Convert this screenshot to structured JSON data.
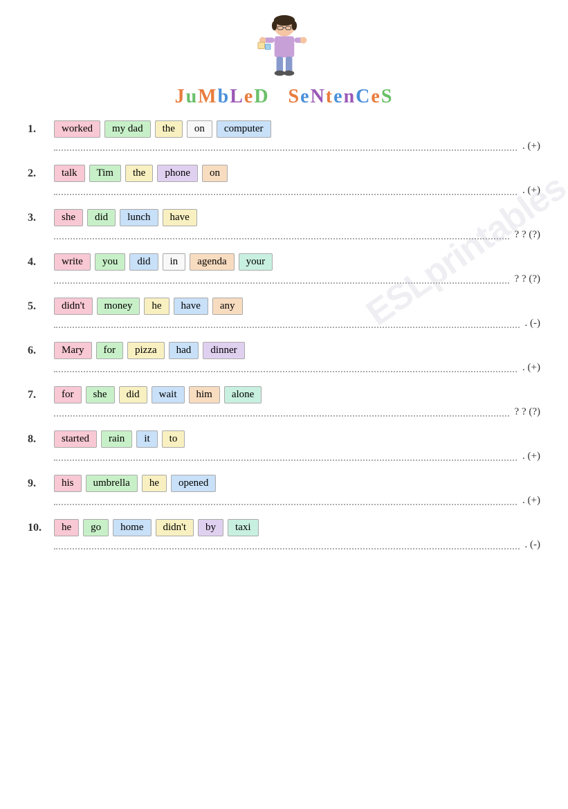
{
  "header": {
    "title": "JuMbLeD SeNtenCeS"
  },
  "exercises": [
    {
      "num": "1.",
      "words": [
        {
          "text": "worked",
          "color": "color-pink"
        },
        {
          "text": "my dad",
          "color": "color-green"
        },
        {
          "text": "the",
          "color": "color-yellow"
        },
        {
          "text": "on",
          "color": "color-white"
        },
        {
          "text": "computer",
          "color": "color-blue"
        }
      ],
      "type": "(+)"
    },
    {
      "num": "2.",
      "words": [
        {
          "text": "talk",
          "color": "color-pink"
        },
        {
          "text": "Tim",
          "color": "color-green"
        },
        {
          "text": "the",
          "color": "color-yellow"
        },
        {
          "text": "phone",
          "color": "color-lavender"
        },
        {
          "text": "on",
          "color": "color-peach"
        }
      ],
      "type": "(+)"
    },
    {
      "num": "3.",
      "words": [
        {
          "text": "she",
          "color": "color-pink"
        },
        {
          "text": "did",
          "color": "color-green"
        },
        {
          "text": "lunch",
          "color": "color-blue"
        },
        {
          "text": "have",
          "color": "color-yellow"
        }
      ],
      "type": "? (?)"
    },
    {
      "num": "4.",
      "words": [
        {
          "text": "write",
          "color": "color-pink"
        },
        {
          "text": "you",
          "color": "color-green"
        },
        {
          "text": "did",
          "color": "color-blue"
        },
        {
          "text": "in",
          "color": "color-white"
        },
        {
          "text": "agenda",
          "color": "color-peach"
        },
        {
          "text": "your",
          "color": "color-mint"
        }
      ],
      "type": "? (?)"
    },
    {
      "num": "5.",
      "words": [
        {
          "text": "didn't",
          "color": "color-pink"
        },
        {
          "text": "money",
          "color": "color-green"
        },
        {
          "text": "he",
          "color": "color-yellow"
        },
        {
          "text": "have",
          "color": "color-blue"
        },
        {
          "text": "any",
          "color": "color-peach"
        }
      ],
      "type": "(-)"
    },
    {
      "num": "6.",
      "words": [
        {
          "text": "Mary",
          "color": "color-pink"
        },
        {
          "text": "for",
          "color": "color-green"
        },
        {
          "text": "pizza",
          "color": "color-yellow"
        },
        {
          "text": "had",
          "color": "color-blue"
        },
        {
          "text": "dinner",
          "color": "color-lavender"
        }
      ],
      "type": "(+)"
    },
    {
      "num": "7.",
      "words": [
        {
          "text": "for",
          "color": "color-pink"
        },
        {
          "text": "she",
          "color": "color-green"
        },
        {
          "text": "did",
          "color": "color-yellow"
        },
        {
          "text": "wait",
          "color": "color-blue"
        },
        {
          "text": "him",
          "color": "color-peach"
        },
        {
          "text": "alone",
          "color": "color-mint"
        }
      ],
      "type": "? (?)"
    },
    {
      "num": "8.",
      "words": [
        {
          "text": "started",
          "color": "color-pink"
        },
        {
          "text": "rain",
          "color": "color-green"
        },
        {
          "text": "it",
          "color": "color-blue"
        },
        {
          "text": "to",
          "color": "color-yellow"
        }
      ],
      "type": "(+)"
    },
    {
      "num": "9.",
      "words": [
        {
          "text": "his",
          "color": "color-pink"
        },
        {
          "text": "umbrella",
          "color": "color-green"
        },
        {
          "text": "he",
          "color": "color-yellow"
        },
        {
          "text": "opened",
          "color": "color-blue"
        }
      ],
      "type": "(+)"
    },
    {
      "num": "10.",
      "words": [
        {
          "text": "he",
          "color": "color-pink"
        },
        {
          "text": "go",
          "color": "color-green"
        },
        {
          "text": "home",
          "color": "color-blue"
        },
        {
          "text": "didn't",
          "color": "color-yellow"
        },
        {
          "text": "by",
          "color": "color-lavender"
        },
        {
          "text": "taxi",
          "color": "color-mint"
        }
      ],
      "type": "(-)"
    }
  ],
  "watermark": "ESLprintables.com"
}
